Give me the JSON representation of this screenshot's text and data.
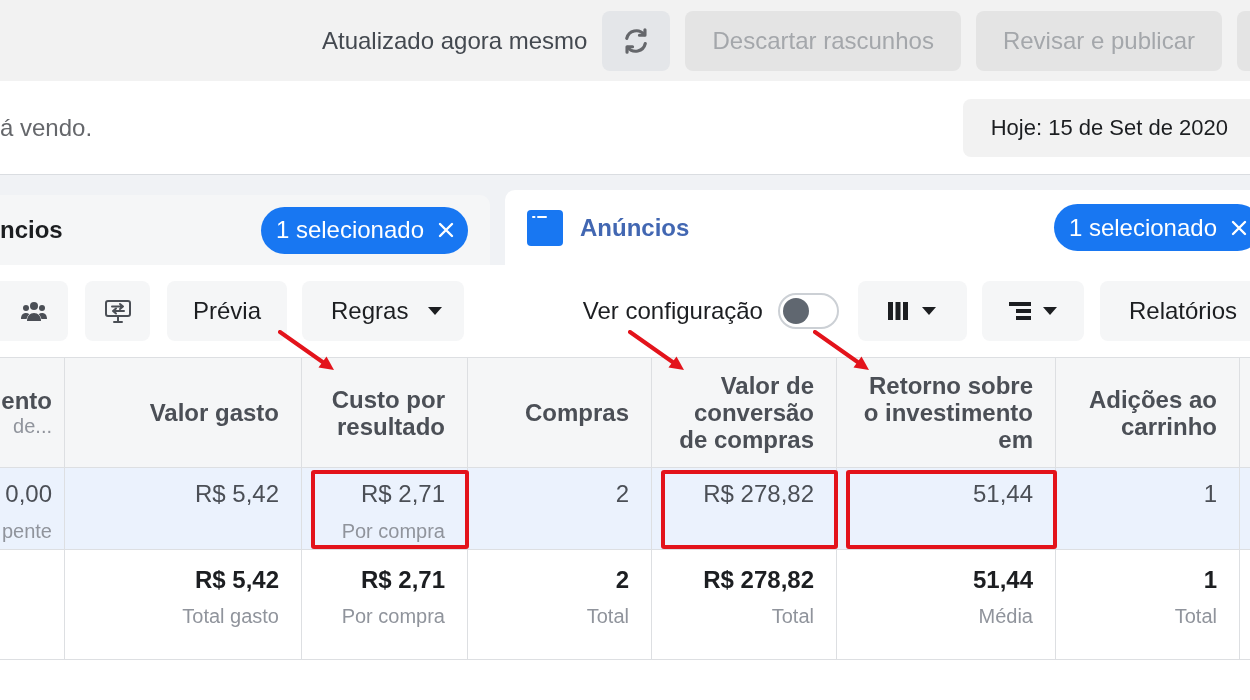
{
  "top_bar": {
    "status": "Atualizado agora mesmo",
    "buttons": [
      {
        "label": "Descartar rascunhos",
        "disabled": true
      },
      {
        "label": "Revisar e publicar",
        "disabled": true
      }
    ]
  },
  "notice_bar": {
    "text": "á vendo.",
    "date_button": "Hoje: 15 de Set de 2020"
  },
  "tabs": [
    {
      "label": "ncios",
      "selected": false,
      "icon": false,
      "badge": "1 selecionado"
    },
    {
      "label": "Anúncios",
      "selected": true,
      "icon": true,
      "badge": "1 selecionado"
    }
  ],
  "toolbar": {
    "preview_button": "Prévia",
    "rules_button": "Regras",
    "view_setting": {
      "label": "Ver configuração",
      "on": false
    },
    "reports_button": "Relatórios"
  },
  "table": {
    "columns": [
      {
        "label": "ento",
        "sublabel": "de...",
        "arrow": false
      },
      {
        "label": "Valor gasto",
        "arrow": false
      },
      {
        "label": "Custo por resultado",
        "arrow": true
      },
      {
        "label": "Compras",
        "arrow": false
      },
      {
        "label": "Valor de conversão de compras",
        "arrow": true
      },
      {
        "label": "Retorno sobre o investimento em",
        "arrow": true
      },
      {
        "label": "Adições ao carrinho",
        "arrow": false
      }
    ],
    "rows": [
      {
        "kind": "data",
        "selected": true,
        "cells": [
          {
            "value": "0,00",
            "note": "pente",
            "highlighted": false
          },
          {
            "value": "R$ 5,42",
            "highlighted": false
          },
          {
            "value": "R$ 2,71",
            "note": "Por compra",
            "highlighted": true
          },
          {
            "value": "2",
            "highlighted": false
          },
          {
            "value": "R$ 278,82",
            "highlighted": true
          },
          {
            "value": "51,44",
            "highlighted": true
          },
          {
            "value": "1",
            "highlighted": false
          }
        ]
      },
      {
        "kind": "total",
        "selected": false,
        "cells": [
          {
            "highlighted": false
          },
          {
            "value": "R$ 5,42",
            "note": "Total gasto",
            "highlighted": false
          },
          {
            "value": "R$ 2,71",
            "note": "Por compra",
            "highlighted": false
          },
          {
            "value": "2",
            "note": "Total",
            "highlighted": false
          },
          {
            "value": "R$ 278,82",
            "note": "Total",
            "highlighted": false
          },
          {
            "value": "51,44",
            "note": "Média",
            "highlighted": false
          },
          {
            "value": "1",
            "note": "Total",
            "highlighted": false
          }
        ]
      }
    ]
  }
}
